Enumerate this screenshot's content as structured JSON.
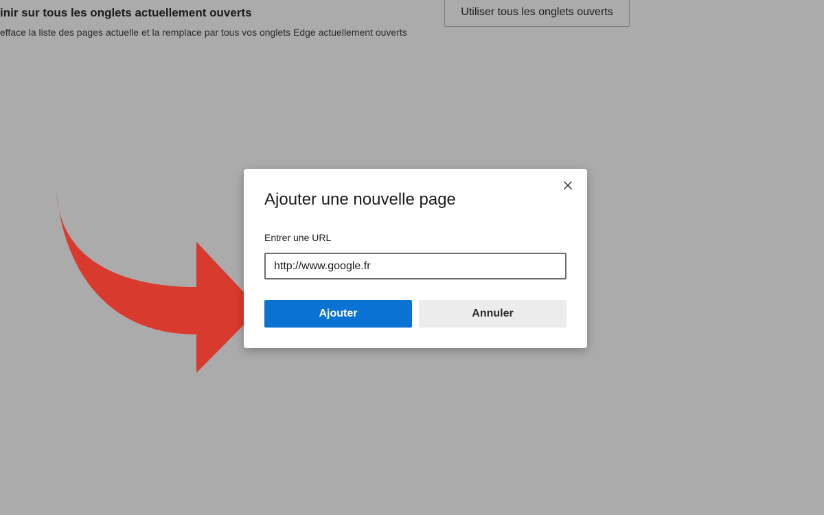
{
  "background": {
    "section_title": "inir sur tous les onglets actuellement ouverts",
    "section_description": "efface la liste des pages actuelle et la remplace par tous vos onglets Edge actuellement ouverts",
    "use_all_tabs_button": "Utiliser tous les onglets ouverts"
  },
  "dialog": {
    "title": "Ajouter une nouvelle page",
    "url_label": "Entrer une URL",
    "url_value": "http://www.google.fr",
    "add_button": "Ajouter",
    "cancel_button": "Annuler",
    "close_icon": "close-icon"
  },
  "annotation": {
    "arrow_icon": "curved-arrow-icon",
    "arrow_color": "#d93a2e"
  },
  "colors": {
    "overlay_background": "#ababab",
    "primary_accent": "#0a72d2",
    "secondary_button": "#ececec"
  }
}
